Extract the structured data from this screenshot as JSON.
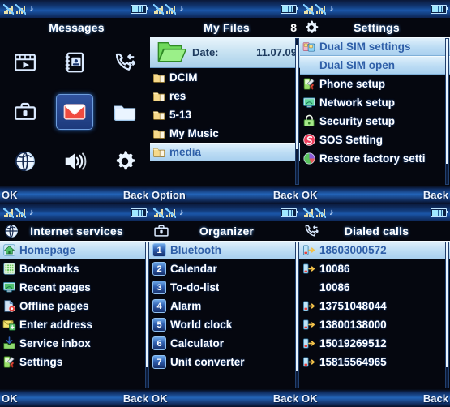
{
  "status": {
    "sim1_icon": "signal-bars-icon",
    "sim2_icon": "signal-bars-icon",
    "music_icon": "music-note-icon",
    "battery_icon": "battery-icon"
  },
  "softkeys": {
    "ok": "OK",
    "back": "Back",
    "option": "Option"
  },
  "panels": [
    {
      "id": "messages-main-menu",
      "title": "Messages",
      "title_icon": "",
      "type": "icon-grid",
      "left_softkey": "OK",
      "right_softkey": "Back",
      "items": [
        {
          "label": "Multimedia",
          "icon": "film-play-icon",
          "selected": false
        },
        {
          "label": "Phonebook",
          "icon": "phonebook-icon",
          "selected": false
        },
        {
          "label": "Call center",
          "icon": "call-log-icon",
          "selected": false
        },
        {
          "label": "Organizer",
          "icon": "briefcase-icon",
          "selected": false
        },
        {
          "label": "Messages",
          "icon": "envelope-icon",
          "selected": true
        },
        {
          "label": "My Files",
          "icon": "folder-icon",
          "selected": false
        },
        {
          "label": "Internet services",
          "icon": "globe-icon",
          "selected": false
        },
        {
          "label": "Profiles",
          "icon": "speaker-icon",
          "selected": false
        },
        {
          "label": "Settings",
          "icon": "gear-icon",
          "selected": false
        }
      ]
    },
    {
      "id": "my-files",
      "title": "My Files",
      "title_icon": "",
      "count": "8",
      "type": "file-list",
      "left_softkey": "Option",
      "right_softkey": "Back",
      "info": {
        "icon": "open-folder-icon",
        "key": "Date:",
        "value": "11.07.09"
      },
      "items": [
        {
          "label": "DCIM",
          "icon": "folder-icon",
          "selected": false
        },
        {
          "label": "res",
          "icon": "folder-icon",
          "selected": false
        },
        {
          "label": "5-13",
          "icon": "folder-icon",
          "selected": false
        },
        {
          "label": "My Music",
          "icon": "folder-icon",
          "selected": false
        },
        {
          "label": "media",
          "icon": "folder-icon",
          "selected": true
        }
      ]
    },
    {
      "id": "settings",
      "title": "Settings",
      "title_icon": "gear-icon",
      "type": "list",
      "left_softkey": "OK",
      "right_softkey": "Back",
      "items": [
        {
          "label": "Dual SIM settings",
          "icon": "dual-sim-icon",
          "selected": true
        },
        {
          "label": "Dual SIM open",
          "icon": "",
          "selected": true
        },
        {
          "label": "Phone setup",
          "icon": "phone-setup-icon",
          "selected": false
        },
        {
          "label": "Network setup",
          "icon": "network-setup-icon",
          "selected": false
        },
        {
          "label": "Security setup",
          "icon": "security-lock-icon",
          "selected": false
        },
        {
          "label": "SOS Setting",
          "icon": "sos-icon",
          "selected": false
        },
        {
          "label": "Restore factory setti",
          "icon": "restore-pie-icon",
          "selected": false
        }
      ]
    },
    {
      "id": "internet-services",
      "title": "Internet services",
      "title_icon": "globe-icon",
      "type": "list",
      "left_softkey": "OK",
      "right_softkey": "Back",
      "items": [
        {
          "label": "Homepage",
          "icon": "home-icon",
          "selected": true
        },
        {
          "label": "Bookmarks",
          "icon": "bookmarks-icon",
          "selected": false
        },
        {
          "label": "Recent pages",
          "icon": "monitor-icon",
          "selected": false
        },
        {
          "label": "Offline pages",
          "icon": "offline-page-icon",
          "selected": false
        },
        {
          "label": "Enter address",
          "icon": "enter-address-icon",
          "selected": false
        },
        {
          "label": "Service inbox",
          "icon": "inbox-down-icon",
          "selected": false
        },
        {
          "label": "Settings",
          "icon": "phone-setup-icon",
          "selected": false
        }
      ]
    },
    {
      "id": "organizer",
      "title": "Organizer",
      "title_icon": "briefcase-icon",
      "type": "numbered-list",
      "left_softkey": "OK",
      "right_softkey": "Back",
      "items": [
        {
          "num": "1",
          "label": "Bluetooth",
          "selected": true
        },
        {
          "num": "2",
          "label": "Calendar",
          "selected": false
        },
        {
          "num": "3",
          "label": "To-do-list",
          "selected": false
        },
        {
          "num": "4",
          "label": "Alarm",
          "selected": false
        },
        {
          "num": "5",
          "label": "World clock",
          "selected": false
        },
        {
          "num": "6",
          "label": "Calculator",
          "selected": false
        },
        {
          "num": "7",
          "label": "Unit converter",
          "selected": false
        }
      ]
    },
    {
      "id": "dialed-calls",
      "title": "Dialed calls",
      "title_icon": "call-log-icon",
      "type": "list",
      "left_softkey": "OK",
      "right_softkey": "Back",
      "items": [
        {
          "label": "18603000572",
          "icon": "dialed-call-icon",
          "selected": true
        },
        {
          "label": "10086",
          "icon": "dialed-call-icon",
          "selected": false
        },
        {
          "label": "10086",
          "icon": "",
          "selected": false
        },
        {
          "label": "13751048044",
          "icon": "dialed-call-icon",
          "selected": false
        },
        {
          "label": "13800138000",
          "icon": "dialed-call-icon",
          "selected": false
        },
        {
          "label": "15019269512",
          "icon": "dialed-call-icon",
          "selected": false
        },
        {
          "label": "15815564965",
          "icon": "dialed-call-icon",
          "selected": false
        }
      ]
    }
  ],
  "colors": {
    "screen_bg": "#05070f",
    "highlight": "#bcdcf4",
    "highlight_text": "#2f5fa8",
    "softkey_text": "#eef5ff",
    "accent_blue": "#2364b8",
    "envelope_red": "#e8453c",
    "folder_yellow": "#f2c75c",
    "folder_green": "#7de06a"
  }
}
